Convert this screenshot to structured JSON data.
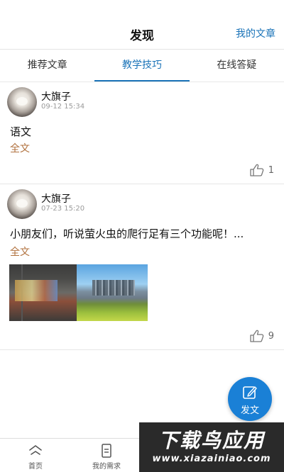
{
  "header": {
    "title": "发现",
    "action": "我的文章"
  },
  "tabs": [
    {
      "label": "推荐文章",
      "active": false
    },
    {
      "label": "教学技巧",
      "active": true
    },
    {
      "label": "在线答疑",
      "active": false
    }
  ],
  "posts": [
    {
      "author": "大旗子",
      "time": "09-12 15:34",
      "content": "语文",
      "fulltext": "全文",
      "likes": "1"
    },
    {
      "author": "大旗子",
      "time": "07-23 15:20",
      "content": "小朋友们，听说萤火虫的爬行足有三个功能呢！...",
      "fulltext": "全文",
      "likes": "9"
    }
  ],
  "fab": {
    "label": "发文"
  },
  "bottom_nav": [
    {
      "label": "首页",
      "icon": "home-icon"
    },
    {
      "label": "我的需求",
      "icon": "document-icon"
    }
  ],
  "watermark": {
    "title": "下载鸟应用",
    "url": "www.xiazainiao.com"
  },
  "colors": {
    "accent": "#1a73b8",
    "fab": "#1a80d6",
    "fulltext": "#b0703c"
  }
}
